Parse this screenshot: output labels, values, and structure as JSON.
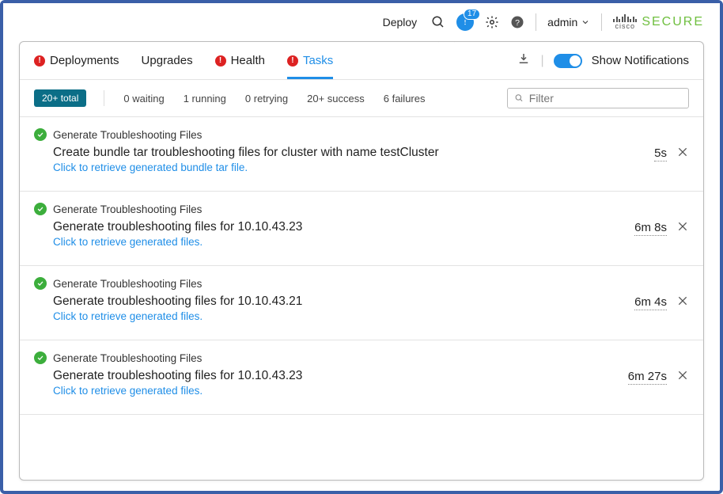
{
  "topbar": {
    "deploy": "Deploy",
    "notif_count": "17",
    "user": "admin",
    "brand_word": "cisco",
    "brand_secure": "SECURE"
  },
  "tabs": {
    "deployments": "Deployments",
    "upgrades": "Upgrades",
    "health": "Health",
    "tasks": "Tasks",
    "show_notifications": "Show Notifications"
  },
  "counts": {
    "total": "20+ total",
    "waiting": "0 waiting",
    "running": "1 running",
    "retrying": "0 retrying",
    "success": "20+ success",
    "failures": "6 failures"
  },
  "filter": {
    "placeholder": "Filter"
  },
  "tasks_list": [
    {
      "title": "Generate Troubleshooting Files",
      "desc": "Create bundle tar troubleshooting files for cluster with name testCluster",
      "link": "Click to retrieve generated bundle tar file.",
      "duration": "5s"
    },
    {
      "title": "Generate Troubleshooting Files",
      "desc": "Generate troubleshooting files for 10.10.43.23",
      "link": "Click to retrieve generated files.",
      "duration": "6m 8s"
    },
    {
      "title": "Generate Troubleshooting Files",
      "desc": "Generate troubleshooting files for 10.10.43.21",
      "link": "Click to retrieve generated files.",
      "duration": "6m 4s"
    },
    {
      "title": "Generate Troubleshooting Files",
      "desc": "Generate troubleshooting files for 10.10.43.23",
      "link": "Click to retrieve generated files.",
      "duration": "6m 27s"
    }
  ]
}
